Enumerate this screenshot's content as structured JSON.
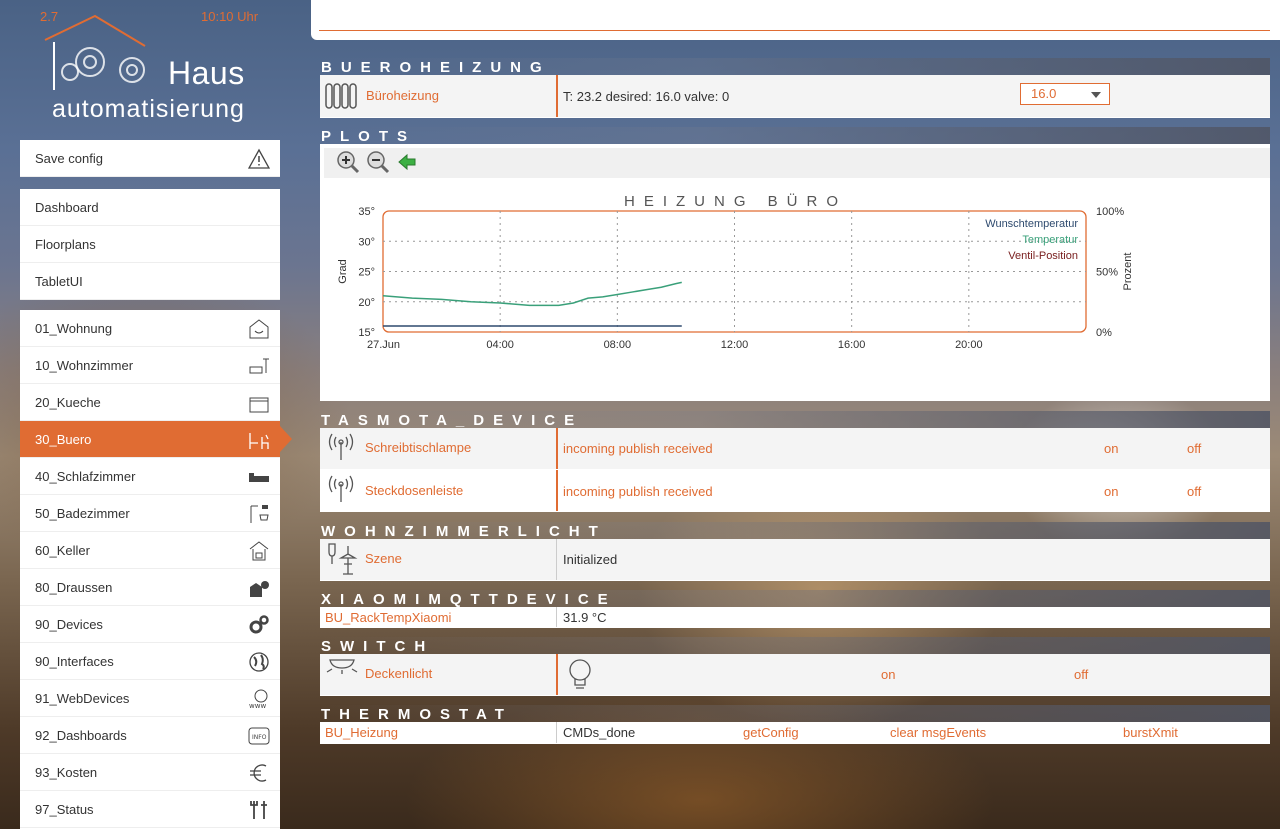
{
  "header": {
    "version": "2.7",
    "time": "10:10 Uhr",
    "logo_line1": "Haus",
    "logo_line2": "automatisierung"
  },
  "sidebar": {
    "save_config": "Save config",
    "top_items": [
      {
        "label": "Dashboard"
      },
      {
        "label": "Floorplans"
      },
      {
        "label": "TabletUI"
      }
    ],
    "rooms": [
      {
        "label": "01_Wohnung",
        "icon": "house-smile-icon"
      },
      {
        "label": "10_Wohnzimmer",
        "icon": "sofa-lamp-icon"
      },
      {
        "label": "20_Kueche",
        "icon": "pot-icon"
      },
      {
        "label": "30_Buero",
        "icon": "desk-chair-icon",
        "active": true
      },
      {
        "label": "40_Schlafzimmer",
        "icon": "bed-icon"
      },
      {
        "label": "50_Badezimmer",
        "icon": "shower-icon"
      },
      {
        "label": "60_Keller",
        "icon": "cellar-icon"
      },
      {
        "label": "80_Draussen",
        "icon": "garden-icon"
      },
      {
        "label": "90_Devices",
        "icon": "gears-icon"
      },
      {
        "label": "90_Interfaces",
        "icon": "globe-icon"
      },
      {
        "label": "91_WebDevices",
        "icon": "www-icon"
      },
      {
        "label": "92_Dashboards",
        "icon": "info-icon"
      },
      {
        "label": "93_Kosten",
        "icon": "euro-icon"
      },
      {
        "label": "97_Status",
        "icon": "tools-icon"
      }
    ]
  },
  "sections": {
    "bueroheizung": {
      "title": "BUEROHEIZUNG",
      "device": "Büroheizung",
      "state": "T: 23.2 desired: 16.0 valve: 0",
      "select_value": "16.0"
    },
    "plots": {
      "title": "PLOTS"
    },
    "tasmota": {
      "title": "TASMOTA_DEVICE",
      "rows": [
        {
          "name": "Schreibtischlampe",
          "state": "incoming publish received",
          "on": "on",
          "off": "off"
        },
        {
          "name": "Steckdosenleiste",
          "state": "incoming publish received",
          "on": "on",
          "off": "off"
        }
      ]
    },
    "wohnzimmerlicht": {
      "title": "WOHNZIMMERLICHT",
      "name": "Szene",
      "state": "Initialized"
    },
    "xiaomi": {
      "title": "XIAOMIMQTTDEVICE",
      "name": "BU_RackTempXiaomi",
      "state": "31.9 °C"
    },
    "switch": {
      "title": "SWITCH",
      "name": "Deckenlicht",
      "on": "on",
      "off": "off"
    },
    "thermostat": {
      "title": "THERMOSTAT",
      "name": "BU_Heizung",
      "state": "CMDs_done",
      "cmds": [
        "getConfig",
        "clear msgEvents",
        "burstXmit"
      ]
    }
  },
  "chart_data": {
    "type": "line",
    "title": "HEIZUNG BÜRO",
    "ylabel": "Grad",
    "y2label": "Prozent",
    "ylim": [
      15,
      35
    ],
    "y2lim": [
      0,
      100
    ],
    "yticks": [
      "35°",
      "30°",
      "25°",
      "20°",
      "15°"
    ],
    "y2ticks": [
      "100%",
      "50%",
      "0%"
    ],
    "xlim": [
      0,
      24
    ],
    "xticks": [
      {
        "v": 0,
        "label": "27.Jun"
      },
      {
        "v": 4,
        "label": "04:00"
      },
      {
        "v": 8,
        "label": "08:00"
      },
      {
        "v": 12,
        "label": "12:00"
      },
      {
        "v": 16,
        "label": "16:00"
      },
      {
        "v": 20,
        "label": "20:00"
      }
    ],
    "grid": true,
    "legend_position": "top-right",
    "series": [
      {
        "name": "Wunschtemperatur",
        "color": "#2e4a6e",
        "x": [
          0,
          10.2
        ],
        "y": [
          16,
          16
        ]
      },
      {
        "name": "Temperatur",
        "color": "#3aa07a",
        "x": [
          0,
          1,
          2,
          3,
          4,
          5,
          6,
          6.5,
          7,
          7.5,
          8,
          8.5,
          9,
          9.5,
          10,
          10.2
        ],
        "y": [
          21,
          20.6,
          20.4,
          20,
          19.8,
          19.4,
          19.4,
          19.8,
          20.6,
          20.8,
          21.2,
          21.6,
          22,
          22.4,
          23,
          23.2
        ]
      },
      {
        "name": "Ventil-Position",
        "color": "#7a2020",
        "x": [],
        "y": []
      }
    ]
  }
}
